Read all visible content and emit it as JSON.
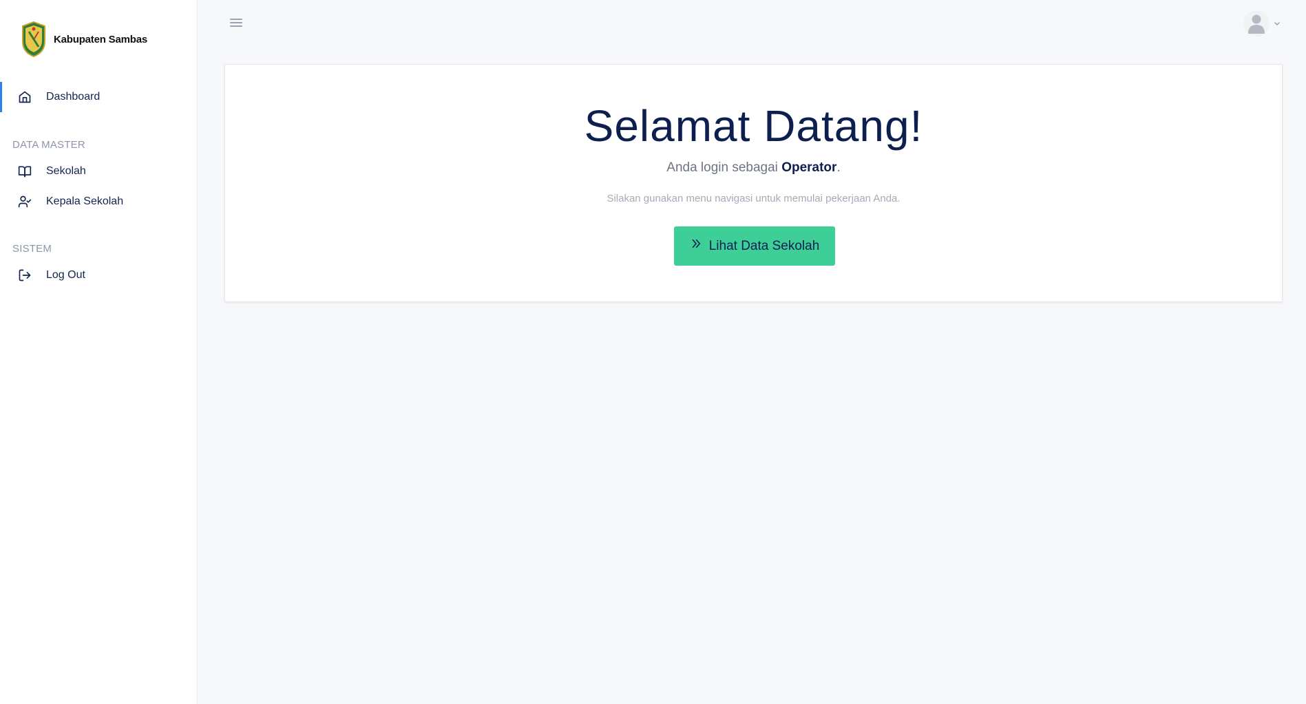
{
  "brand": {
    "name": "Kabupaten Sambas",
    "logo_icon": "kabupaten-sambas-crest"
  },
  "sidebar": {
    "items": [
      {
        "label": "Dashboard",
        "icon": "home-icon",
        "active": true
      }
    ],
    "sections": [
      {
        "title": "DATA MASTER",
        "items": [
          {
            "label": "Sekolah",
            "icon": "book-open-icon"
          },
          {
            "label": "Kepala Sekolah",
            "icon": "user-check-icon"
          }
        ]
      },
      {
        "title": "SISTEM",
        "items": [
          {
            "label": "Log Out",
            "icon": "log-out-icon"
          }
        ]
      }
    ]
  },
  "topbar": {
    "toggle_icon": "menu-icon",
    "user_icon": "user-avatar-icon",
    "chevron_icon": "chevron-down-icon"
  },
  "main": {
    "title": "Selamat Datang!",
    "subtitle_prefix": "Anda login sebagai ",
    "role": "Operator",
    "subtitle_suffix": ".",
    "hint": "Silakan gunakan menu navigasi untuk memulai pekerjaan Anda.",
    "cta_label": "Lihat Data Sekolah",
    "cta_icon": "chevrons-right-icon"
  },
  "colors": {
    "accent": "#2f80ed",
    "cta_background": "#3ecf98",
    "heading": "#0d1f4f",
    "page_background": "#f7f8fa"
  }
}
